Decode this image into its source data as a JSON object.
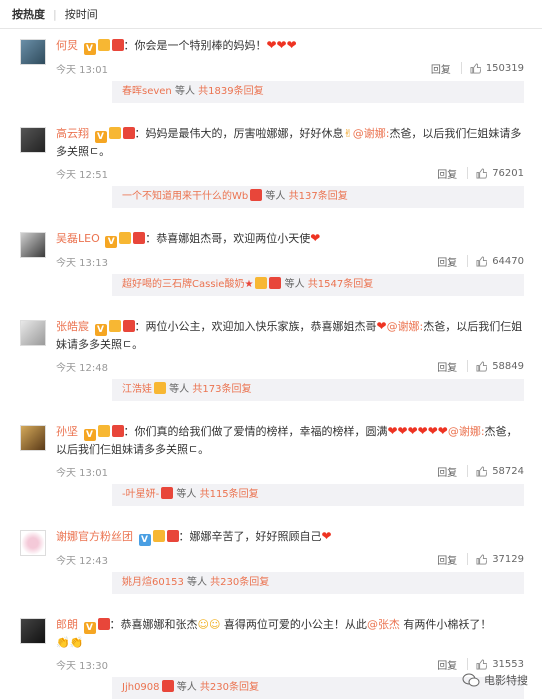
{
  "sort": {
    "hot": "按热度",
    "time": "按时间"
  },
  "comments": [
    {
      "user": "何炅",
      "text": "你会是一个特别棒的妈妈！",
      "emoji": "❤❤❤",
      "time": "今天 13:01",
      "reply": "回复",
      "likes": "150319",
      "sub": {
        "user": "春晖seven",
        "suffix": " 等人 ",
        "total": "共1839条回复"
      }
    },
    {
      "user": "高云翔",
      "text": "妈妈是最伟大的，厉害啦娜娜，好好休息",
      "mention": "@谢娜:",
      "text2": "杰爸，以后我们仨姐妹请多多关照ㄷ。",
      "time": "今天 12:51",
      "reply": "回复",
      "likes": "76201",
      "sub": {
        "user": "一个不知道用来干什么的Wb",
        "suffix": " 等人 ",
        "total": "共137条回复"
      }
    },
    {
      "user": "吴磊LEO",
      "text": "恭喜娜姐杰哥，欢迎两位小天使",
      "emoji": "❤",
      "time": "今天 13:13",
      "reply": "回复",
      "likes": "64470",
      "sub": {
        "user": "超好喝的三石牌Cassie酸奶",
        "suffix": " 等人 ",
        "total": "共1547条回复"
      }
    },
    {
      "user": "张皓宸",
      "text": "两位小公主，欢迎加入快乐家族，恭喜娜姐杰哥",
      "mention": "@谢娜:",
      "text2": "杰爸，以后我们仨姐妹请多多关照ㄷ。",
      "time": "今天 12:48",
      "reply": "回复",
      "likes": "58849",
      "sub": {
        "user": "江浩娃",
        "suffix": " 等人 ",
        "total": "共173条回复"
      }
    },
    {
      "user": "孙坚",
      "text": "你们真的给我们做了爱情的榜样，幸福的榜样，圆满",
      "emoji": "❤❤❤❤❤❤",
      "mention": "@谢娜:",
      "text2": "杰爸，以后我们仨姐妹请多多关照ㄷ。",
      "time": "今天 13:01",
      "reply": "回复",
      "likes": "58724",
      "sub": {
        "user": "-叶星妍-",
        "suffix": " 等人 ",
        "total": "共115条回复"
      }
    },
    {
      "user": "谢娜官方粉丝团",
      "text": "娜娜辛苦了，好好照顾自己",
      "emoji": "❤",
      "time": "今天 12:43",
      "reply": "回复",
      "likes": "37129",
      "sub": {
        "user": "姚月煊60153",
        "suffix": " 等人 ",
        "total": "共230条回复"
      }
    },
    {
      "user": "郎朗",
      "text": "恭喜娜娜和张杰",
      "text_b": " 喜得两位可爱的小公主！从此",
      "mention": "@张杰",
      "text2": " 有两件小棉袄了！",
      "time": "今天 13:30",
      "reply": "回复",
      "likes": "31553",
      "sub": {
        "user": "Jjh0908",
        "suffix": " 等人 ",
        "total": "共230条回复"
      }
    }
  ],
  "watermark": "电影特搜",
  "colors": {
    "username": "#eb7350",
    "subbox_bg": "#f2f2f5"
  }
}
